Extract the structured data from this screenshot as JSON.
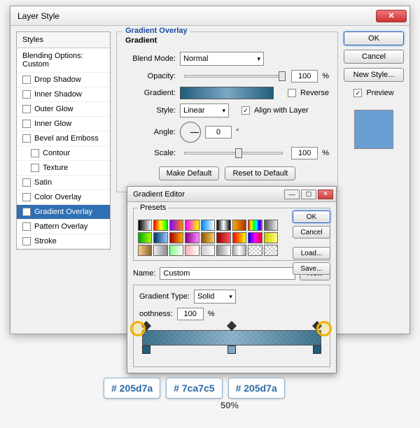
{
  "dialog": {
    "title": "Layer Style",
    "ok": "OK",
    "cancel": "Cancel",
    "newStyle": "New Style...",
    "previewLabel": "Preview"
  },
  "styles": {
    "header": "Styles",
    "blending": "Blending Options: Custom",
    "items": [
      {
        "label": "Drop Shadow",
        "on": false,
        "ind": false
      },
      {
        "label": "Inner Shadow",
        "on": false,
        "ind": false
      },
      {
        "label": "Outer Glow",
        "on": false,
        "ind": false
      },
      {
        "label": "Inner Glow",
        "on": false,
        "ind": false
      },
      {
        "label": "Bevel and Emboss",
        "on": false,
        "ind": false
      },
      {
        "label": "Contour",
        "on": false,
        "ind": true
      },
      {
        "label": "Texture",
        "on": false,
        "ind": true
      },
      {
        "label": "Satin",
        "on": false,
        "ind": false
      },
      {
        "label": "Color Overlay",
        "on": false,
        "ind": false
      },
      {
        "label": "Gradient Overlay",
        "on": true,
        "ind": false,
        "sel": true
      },
      {
        "label": "Pattern Overlay",
        "on": false,
        "ind": false
      },
      {
        "label": "Stroke",
        "on": false,
        "ind": false
      }
    ]
  },
  "grad": {
    "title": "Gradient Overlay",
    "subtitle": "Gradient",
    "blendMode": {
      "label": "Blend Mode:",
      "value": "Normal"
    },
    "opacity": {
      "label": "Opacity:",
      "value": "100",
      "unit": "%"
    },
    "gradient": {
      "label": "Gradient:",
      "reverse": "Reverse"
    },
    "style": {
      "label": "Style:",
      "value": "Linear",
      "align": "Align with Layer"
    },
    "angle": {
      "label": "Angle:",
      "value": "0",
      "unit": "°"
    },
    "scale": {
      "label": "Scale:",
      "value": "100",
      "unit": "%"
    },
    "makeDefault": "Make Default",
    "resetDefault": "Reset to Default"
  },
  "ge": {
    "title": "Gradient Editor",
    "presets": "Presets",
    "ok": "OK",
    "cancel": "Cancel",
    "load": "Load...",
    "save": "Save...",
    "nameLabel": "Name:",
    "nameValue": "Custom",
    "new": "New",
    "gtypeLabel": "Gradient Type:",
    "gtypeValue": "Solid",
    "smoothLabel": "oothness:",
    "smoothValue": "100",
    "smoothUnit": "%"
  },
  "swatchColors": [
    "linear-gradient(90deg,#000,#fff)",
    "linear-gradient(90deg,#f00,#ff0,#0f0)",
    "linear-gradient(90deg,#80f,#f80)",
    "linear-gradient(90deg,#f0f,#ff0)",
    "linear-gradient(90deg,#08f,#fff)",
    "linear-gradient(90deg,#000,#fff,#000)",
    "linear-gradient(90deg,#fa0,#a30)",
    "linear-gradient(90deg,#f00,#ff0,#0f0,#0ff,#00f,#f0f)",
    "linear-gradient(90deg,#555,#eee)",
    "linear-gradient(90deg,#0a0,#af0)",
    "linear-gradient(90deg,#036,#9cf)",
    "linear-gradient(90deg,#a00,#fa0)",
    "linear-gradient(90deg,#808,#f8f)",
    "linear-gradient(90deg,#850,#fc6)",
    "linear-gradient(90deg,#900,#f55)",
    "linear-gradient(90deg,#f00,#ff0)",
    "linear-gradient(90deg,#00f,#f0f,#f00)",
    "linear-gradient(90deg,#cc0,#ff8)",
    "linear-gradient(90deg,#fc8,#863)",
    "linear-gradient(90deg,#eee,#888)",
    "linear-gradient(90deg,#8f8,#fff)",
    "linear-gradient(90deg,#faa,#fff)",
    "linear-gradient(90deg,#ccc,#fff)",
    "linear-gradient(90deg,#888,#fff)",
    "linear-gradient(90deg,#aaa,#fff,#aaa)",
    "repeating-conic-gradient(#ccc 0 25%,#fff 0 50%) 0 0/6px 6px",
    "repeating-conic-gradient(#ccc 0 25%,#fff 0 50%) 0 0/6px 6px"
  ],
  "annotations": {
    "c1": "# 205d7a",
    "c2": "# 7ca7c5",
    "c3": "# 205d7a",
    "pct": "50%"
  }
}
